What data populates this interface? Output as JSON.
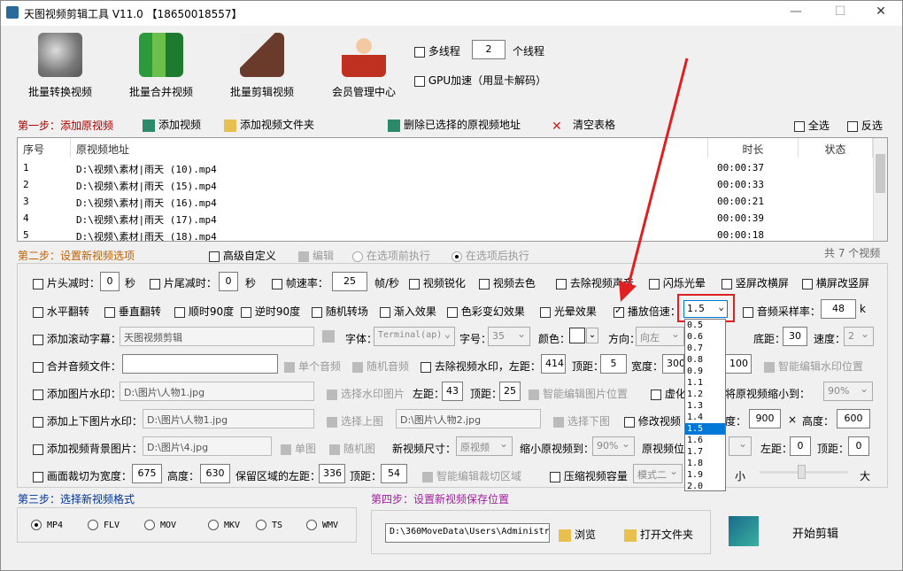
{
  "window": {
    "title": "天图视频剪辑工具 V11.0 【18650018557】",
    "minimize": "—",
    "maximize": "☐",
    "close": "✕"
  },
  "toolbar": {
    "buttons": [
      {
        "label": "批量转换视频"
      },
      {
        "label": "批量合并视频"
      },
      {
        "label": "批量剪辑视频"
      },
      {
        "label": "会员管理中心"
      }
    ],
    "multithread_label": "多线程",
    "thread_count": "2",
    "thread_unit": "个线程",
    "gpu_label": "GPU加速（用显卡解码）"
  },
  "step1": {
    "label": "第一步：添加原视频",
    "add_video": "添加视频",
    "add_folder": "添加视频文件夹",
    "delete_selected": "删除已选择的原视频地址",
    "clear_table": "清空表格",
    "select_all": "全选",
    "invert": "反选",
    "columns": [
      "序号",
      "原视频地址",
      "时长",
      "状态"
    ],
    "rows": [
      {
        "idx": "1",
        "path": "D:\\视频\\素材|雨天 (10).mp4",
        "dur": "00:00:37",
        "status": ""
      },
      {
        "idx": "2",
        "path": "D:\\视频\\素材|雨天 (15).mp4",
        "dur": "00:00:33",
        "status": ""
      },
      {
        "idx": "3",
        "path": "D:\\视频\\素材|雨天 (16).mp4",
        "dur": "00:00:21",
        "status": ""
      },
      {
        "idx": "4",
        "path": "D:\\视频\\素材|雨天 (17).mp4",
        "dur": "00:00:39",
        "status": ""
      },
      {
        "idx": "5",
        "path": "D:\\视频\\素材|雨天 (18).mp4",
        "dur": "00:00:18",
        "status": ""
      }
    ],
    "total": "共 7 个视频"
  },
  "step2": {
    "label": "第二步：设置新视频选项",
    "advanced": "高级自定义",
    "edit": "编辑",
    "exec_before": "在选项前执行",
    "exec_after": "在选项后执行",
    "row1": {
      "head_trim": "片头减时：",
      "head_val": "0",
      "sec1": "秒",
      "tail_trim": "片尾减时：",
      "tail_val": "0",
      "sec2": "秒",
      "fps": "帧速率：",
      "fps_val": "25",
      "fps_unit": "帧/秒",
      "sharpen": "视频锐化",
      "decolor": "视频去色",
      "mute": "去除视频声音",
      "flash": "闪烁光晕",
      "v2h": "竖屏改横屏",
      "h2v": "横屏改竖屏"
    },
    "row2": {
      "hflip": "水平翻转",
      "vflip": "垂直翻转",
      "cw90": "顺时90度",
      "ccw90": "逆时90度",
      "random_trans": "随机转场",
      "fadein": "渐入效果",
      "color_fx": "色彩变幻效果",
      "halo": "光晕效果",
      "speed": "播放倍速：",
      "speed_val": "1.5",
      "sample": "音频采样率：",
      "sample_val": "48",
      "sample_unit": "k"
    },
    "row3": {
      "scroll": "添加滚动字幕：",
      "scroll_text": "天图视频剪辑",
      "font": "字体：",
      "font_val": "Terminal(ap)",
      "size": "字号：",
      "size_val": "35",
      "color": "颜色：",
      "dir": "方向：",
      "dir_val": "向左",
      "bottom": "底距：",
      "bottom_val": "30",
      "speed": "速度：",
      "speed_val": "2"
    },
    "row4": {
      "merge_audio": "合并音频文件：",
      "single_audio": "单个音频",
      "random_audio": "随机音频",
      "remove_wm": "去除视频水印，左距：",
      "left_val": "414",
      "top": "顶距：",
      "top_val": "5",
      "width": "宽度：",
      "width_val": "300",
      "height_val": "100",
      "smart_wm": "智能编辑水印位置"
    },
    "row5": {
      "img_wm": "添加图片水印：",
      "img_path": "D:\\图片\\人物1.jpg",
      "choose_img": "选择水印图片",
      "left": "左距：",
      "left_val": "43",
      "top": "顶距：",
      "top_val": "25",
      "smart_img": "智能编辑图片位置",
      "blur_prefix": "虚化",
      "shrink": "将原视频缩小到：",
      "shrink_val": "90%"
    },
    "row6": {
      "updown": "添加上下图片水印：",
      "up_path": "D:\\图片\\人物1.jpg",
      "choose_up": "选择上图",
      "down_path": "D:\\图片\\人物2.jpg",
      "choose_down": "选择下图",
      "modify_prefix": "修改视频",
      "width_suffix": "度：",
      "w_val": "900",
      "x": "×",
      "height": "高度：",
      "h_val": "600"
    },
    "row7": {
      "bg": "添加视频背景图片：",
      "bg_path": "D:\\图片\\4.jpg",
      "single": "单图",
      "random": "随机图",
      "newsize": "新视频尺寸：",
      "newsize_val": "原视频",
      "shrink": "缩小原视频到：",
      "shrink_val": "90%",
      "pos_prefix": "原视频位",
      "left": "左距：",
      "left_val": "0",
      "top": "顶距：",
      "top_val": "0"
    },
    "row8": {
      "crop": "画面裁切为宽度：",
      "crop_w": "675",
      "h": "高度：",
      "crop_h": "630",
      "keep": "保留区域的左距：",
      "keep_left": "336",
      "top": "顶距：",
      "keep_top": "54",
      "smart_crop": "智能编辑裁切区域",
      "compress": "压缩视频容量",
      "mode": "模式二",
      "small": "小",
      "big": "大"
    },
    "speed_options": [
      "0.5",
      "0.6",
      "0.7",
      "0.8",
      "0.9",
      "1.1",
      "1.2",
      "1.3",
      "1.4",
      "1.5",
      "1.6",
      "1.7",
      "1.8",
      "1.9",
      "2.0"
    ],
    "speed_selected": "1.5"
  },
  "step3": {
    "label": "第三步：选择新视频格式",
    "formats": [
      "MP4",
      "FLV",
      "MOV",
      "MKV",
      "TS",
      "WMV"
    ],
    "selected": "MP4"
  },
  "step4": {
    "label": "第四步：设置新视频保存位置",
    "path": "D:\\360MoveData\\Users\\Administr",
    "browse": "浏览",
    "open_folder": "打开文件夹",
    "start": "开始剪辑"
  },
  "colors": {
    "red": "#a00000",
    "blue": "#003399",
    "purple": "#a020a0",
    "highlight": "#0078d7",
    "annotation": "#e02020"
  }
}
